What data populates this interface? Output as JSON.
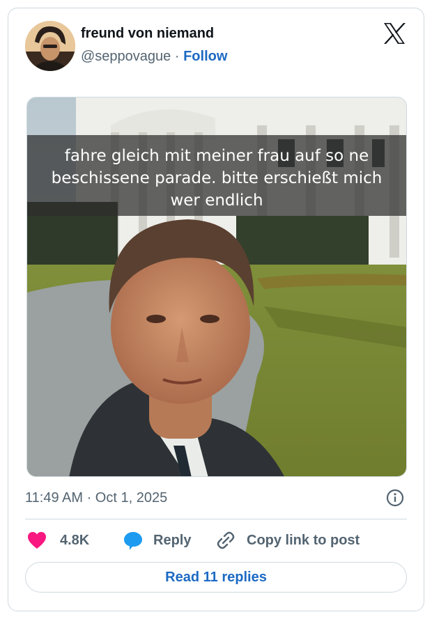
{
  "tweet": {
    "author_name": "freund von niemand",
    "handle": "@seppovague",
    "separator": " · ",
    "follow_label": "Follow",
    "brand_icon": "x-logo-icon",
    "caption": "fahre gleich mit meiner frau auf so ne beschissene parade. bitte erschießt mich wer endlich",
    "timestamp": "11:49 AM · Oct 1, 2025",
    "likes_count": "4.8K",
    "reply_label": "Reply",
    "copy_link_label": "Copy link to post",
    "read_replies_label": "Read 11 replies"
  },
  "colors": {
    "link_blue": "#1d6ac3",
    "heart_pink": "#f91880",
    "reply_blue": "#1d9bf0",
    "muted_text": "#536471",
    "border": "#cfd9de"
  }
}
